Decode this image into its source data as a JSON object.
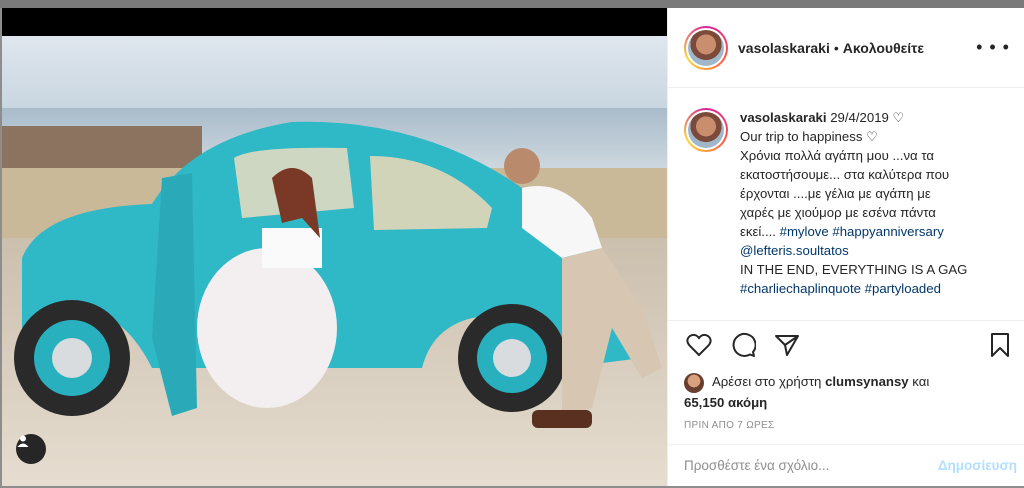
{
  "header": {
    "username": "vasolaskaraki",
    "separator": "•",
    "follow_label": "Ακολουθείτε",
    "more_label": "• • •"
  },
  "caption": {
    "username": "vasolaskaraki",
    "date": "29/4/2019 ♡",
    "lines": [
      "Our trip to happiness ♡",
      "Χρόνια πολλά αγάπη μου ...να τα",
      "εκατοστήσουμε... στα καλύτερα που",
      "έρχονται ....με γέλια με αγάπη με",
      "χαρές με χιούμορ με εσένα πάντα"
    ],
    "line6_prefix": "εκεί.... ",
    "hashtag_mylove": "#mylove",
    "hashtag_anniversary": "#happyanniversary",
    "mention": "@lefteris.soultatos",
    "line8": "IN THE END, EVERYTHING IS A GAG",
    "hashtag_charlie": "#charliechaplinquote",
    "hashtag_party": "#partyloaded"
  },
  "likes": {
    "prefix": "Αρέσει στο χρήστη",
    "user": "clumsynansy",
    "and": "και",
    "count": "65,150 ακόμη"
  },
  "timestamp": "ΠΡΙΝ ΑΠΟ 7 ΩΡΕΣ",
  "comment": {
    "placeholder": "Προσθέστε ένα σχόλιο...",
    "post_label": "Δημοσίευση"
  },
  "colors": {
    "car": "#2fb8c6",
    "link": "#00376b",
    "post_disabled": "#b2dffc"
  },
  "icons": [
    "heart-icon",
    "comment-icon",
    "share-icon",
    "bookmark-icon",
    "more-icon",
    "user-tag-icon"
  ]
}
